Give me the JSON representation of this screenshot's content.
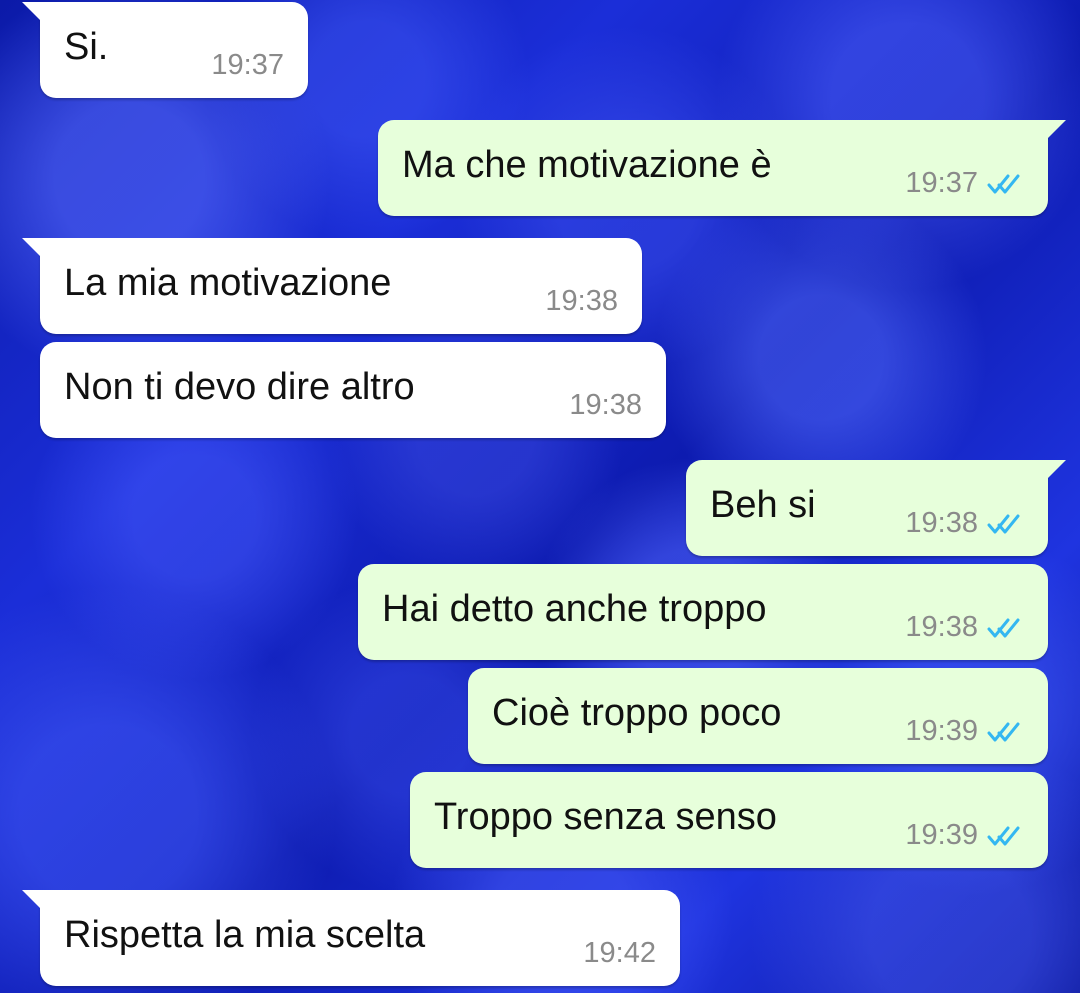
{
  "messages": [
    {
      "text": "Si.",
      "time": "19:37",
      "direction": "incoming"
    },
    {
      "text": "Ma che motivazione è",
      "time": "19:37",
      "direction": "outgoing",
      "status_icon": "double-check-read-icon"
    },
    {
      "text": "La mia motivazione",
      "time": "19:38",
      "direction": "incoming"
    },
    {
      "text": "Non ti devo dire altro",
      "time": "19:38",
      "direction": "incoming"
    },
    {
      "text": "Beh si",
      "time": "19:38",
      "direction": "outgoing",
      "status_icon": "double-check-read-icon"
    },
    {
      "text": "Hai detto anche troppo",
      "time": "19:38",
      "direction": "outgoing",
      "status_icon": "double-check-read-icon"
    },
    {
      "text": "Cioè troppo poco",
      "time": "19:39",
      "direction": "outgoing",
      "status_icon": "double-check-read-icon"
    },
    {
      "text": "Troppo senza senso",
      "time": "19:39",
      "direction": "outgoing",
      "status_icon": "double-check-read-icon"
    },
    {
      "text": "Rispetta la mia scelta",
      "time": "19:42",
      "direction": "incoming"
    }
  ],
  "colors": {
    "incoming_bubble": "#ffffff",
    "outgoing_bubble": "#e7ffdb",
    "read_receipt": "#34b7f1",
    "background_primary": "#1b2ed8"
  }
}
